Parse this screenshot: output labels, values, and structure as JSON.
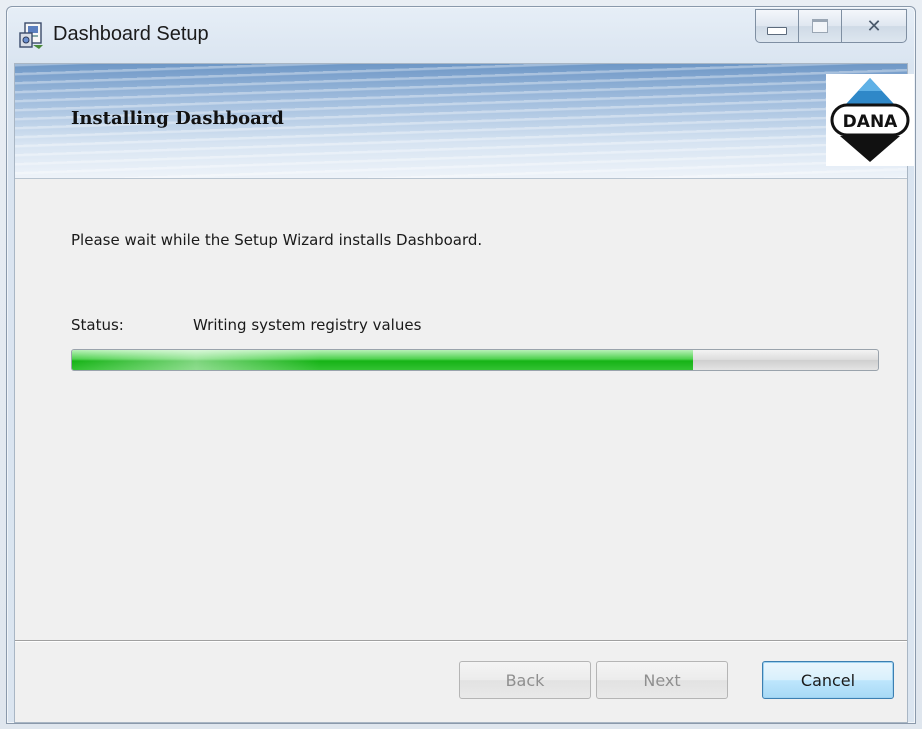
{
  "window": {
    "title": "Dashboard Setup",
    "caption_buttons": [
      "minimize",
      "maximize",
      "close"
    ],
    "close_glyph": "✕"
  },
  "banner": {
    "title": "Installing Dashboard",
    "logo_text": "DANA"
  },
  "content": {
    "message": "Please wait while the Setup Wizard installs Dashboard.",
    "status_label": "Status:",
    "status_value": "Writing system registry values",
    "progress_fraction": 0.77
  },
  "buttons": {
    "back": "Back",
    "next": "Next",
    "cancel": "Cancel"
  },
  "colors": {
    "progress": "#22b822",
    "banner_blue": "#6e97c6",
    "cancel_focus_border": "#3c7fb1",
    "logo_blue": "#2f88c8"
  },
  "icons": {
    "app": "installer-icon",
    "minimize": "minimize-icon",
    "maximize": "maximize-icon",
    "close": "close-icon",
    "logo": "dana-logo"
  }
}
